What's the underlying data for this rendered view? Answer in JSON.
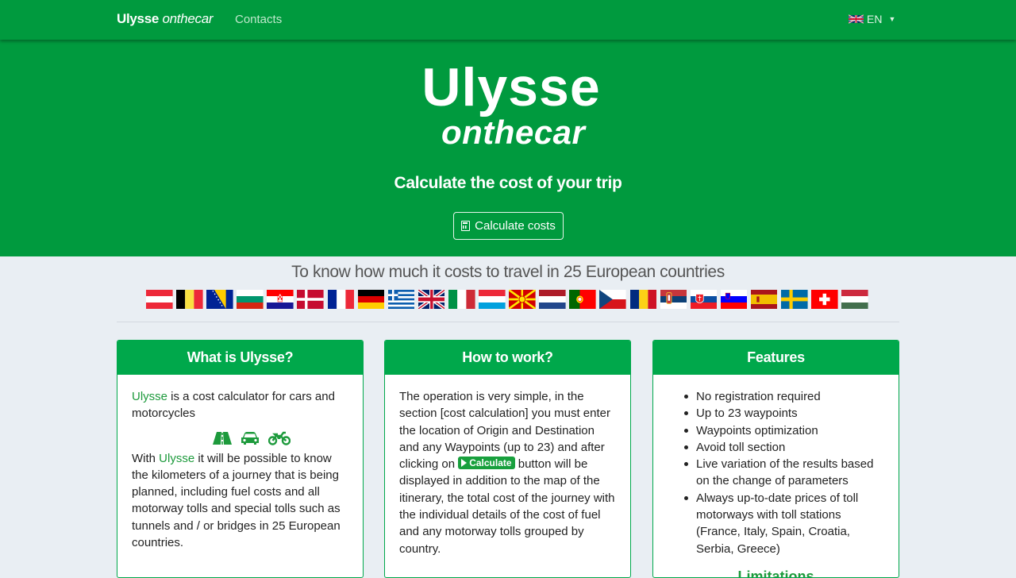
{
  "nav": {
    "brand_main": "Ulysse",
    "brand_italic": "onthecar",
    "contacts": "Contacts",
    "language": "EN",
    "language_flag_icon": "uk-flag-icon"
  },
  "hero": {
    "logo_line1": "Ulysse",
    "logo_line2": "onthecar",
    "tagline": "Calculate the cost of your trip",
    "button": "Calculate costs",
    "button_icon": "calculator-icon"
  },
  "countries": {
    "title": "To know how much it costs to travel in 25 European countries",
    "flags": [
      "Austria",
      "Belgium",
      "Bosnia and Herzegovina",
      "Bulgaria",
      "Croatia",
      "Denmark",
      "France",
      "Germany",
      "Greece",
      "United Kingdom",
      "Italy",
      "Luxembourg",
      "North Macedonia",
      "Netherlands",
      "Portugal",
      "Czech Republic",
      "Romania",
      "Serbia",
      "Slovakia",
      "Slovenia",
      "Spain",
      "Sweden",
      "Switzerland",
      "Hungary"
    ]
  },
  "card1": {
    "title": "What is Ulysse?",
    "p1_brand": "Ulysse",
    "p1_rest": " is a cost calculator for cars and motorcycles",
    "icons": [
      "road-icon",
      "car-icon",
      "motorcycle-icon"
    ],
    "p2_start": "With ",
    "p2_brand": "Ulysse",
    "p2_rest": " it will be possible to know the kilometers of a journey that is being planned, including fuel costs and all motorway tolls and special tolls such as tunnels and / or bridges in 25 European countries."
  },
  "card2": {
    "title": "How to work?",
    "text_before": "The operation is very simple, in the section [cost calculation] you must enter the location of Origin and Destination and any Waypoints (up to 23) and after clicking on ",
    "pill_label": "Calculate",
    "text_after": " button will be displayed in addition to the map of the itinerary, the total cost of the journey with the individual details of the cost of fuel and any motorway tolls grouped by country."
  },
  "card3": {
    "title": "Features",
    "items": [
      "No registration required",
      "Up to 23 waypoints",
      "Waypoints optimization",
      "Avoid toll section",
      "Live variation of the results based on the change of parameters",
      "Always up-to-date prices of toll motorways with toll stations (France, Italy, Spain, Croatia, Serbia, Greece)"
    ],
    "subheading": "Limitations"
  },
  "colors": {
    "brand_green": "#009a3e",
    "card_green": "#00a84b",
    "page_bg": "#e9eef3"
  }
}
